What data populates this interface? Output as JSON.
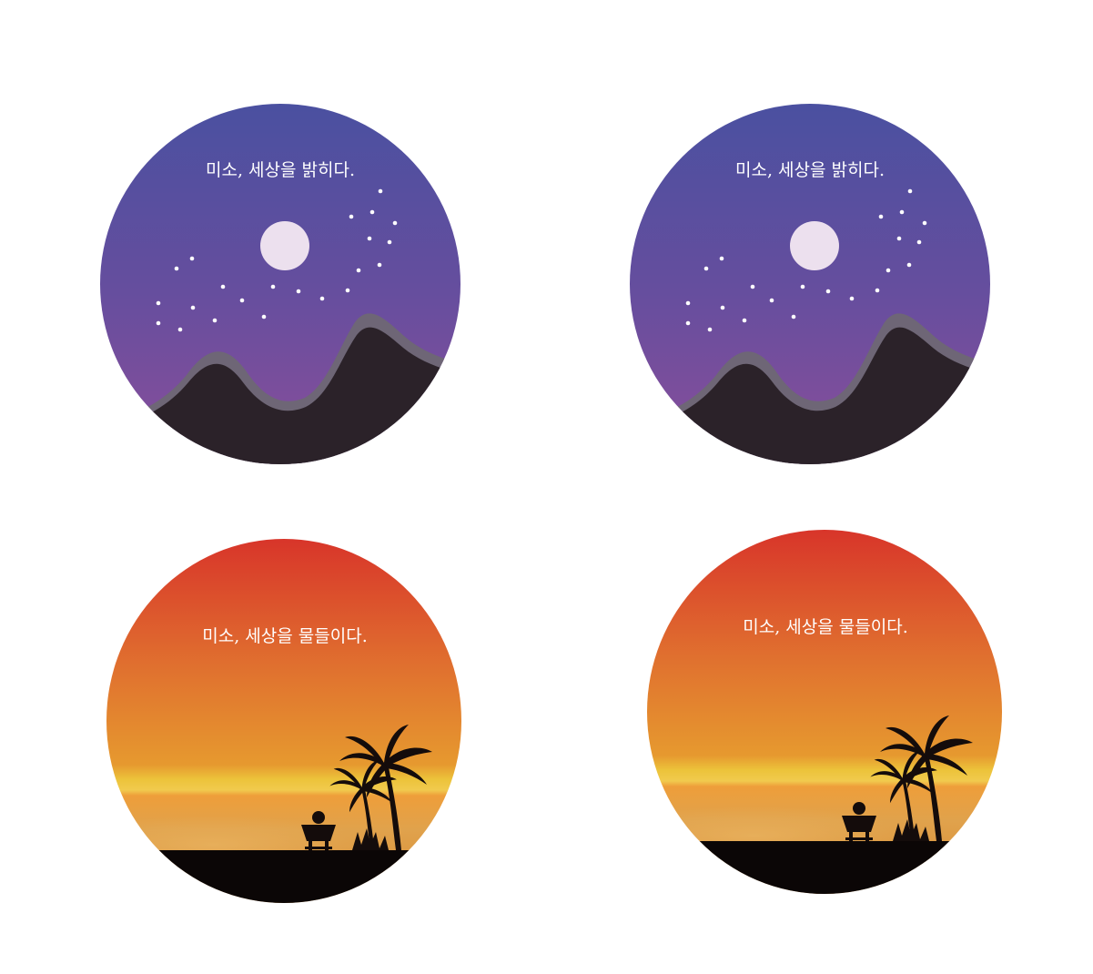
{
  "badges": {
    "night_left": {
      "caption": "미소, 세상을 밝히다."
    },
    "night_right": {
      "caption": "미소, 세상을 밝히다."
    },
    "sunset_left": {
      "caption": "미소, 세상을 물들이다."
    },
    "sunset_right": {
      "caption": "미소, 세상을 물들이다."
    }
  },
  "colors": {
    "night_sky_top": "#4a50a0",
    "night_sky_mid": "#6a4e9c",
    "night_sky_bottom": "#8a4e9a",
    "mountain": "#2b2229",
    "mountain_rim": "#6c6474",
    "moon": "#ece0ee",
    "sunset_top": "#d93a2c",
    "sunset_mid": "#e3812f",
    "sunset_horizon": "#f0c64a",
    "sea": "#e1a54b",
    "ground": "#0b0606"
  }
}
